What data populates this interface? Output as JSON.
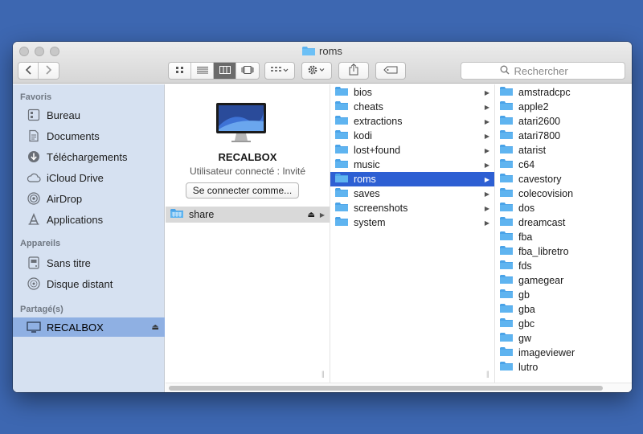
{
  "window": {
    "title": "roms"
  },
  "toolbar": {
    "search_placeholder": "Rechercher",
    "icons": [
      "back-icon",
      "forward-icon",
      "icon-view-icon",
      "list-view-icon",
      "column-view-icon",
      "coverflow-view-icon",
      "group-icon",
      "gear-icon",
      "share-icon",
      "tag-icon",
      "search-icon"
    ]
  },
  "sidebar": {
    "favorites_title": "Favoris",
    "favorites": [
      {
        "label": "Bureau",
        "icon": "desktop-icon"
      },
      {
        "label": "Documents",
        "icon": "documents-icon"
      },
      {
        "label": "Téléchargements",
        "icon": "downloads-icon"
      },
      {
        "label": "iCloud Drive",
        "icon": "cloud-icon"
      },
      {
        "label": "AirDrop",
        "icon": "airdrop-icon"
      },
      {
        "label": "Applications",
        "icon": "applications-icon"
      }
    ],
    "devices_title": "Appareils",
    "devices": [
      {
        "label": "Sans titre",
        "icon": "disk-icon"
      },
      {
        "label": "Disque distant",
        "icon": "optical-disk-icon"
      }
    ],
    "shared_title": "Partagé(s)",
    "shared": [
      {
        "label": "RECALBOX",
        "icon": "network-computer-icon"
      }
    ]
  },
  "server": {
    "name": "RECALBOX",
    "status": "Utilisateur connecté : Invité",
    "connect_label": "Se connecter comme...",
    "share_label": "share"
  },
  "column2": [
    "bios",
    "cheats",
    "extractions",
    "kodi",
    "lost+found",
    "music",
    "roms",
    "saves",
    "screenshots",
    "system"
  ],
  "column2_selected": "roms",
  "column3": [
    "amstradcpc",
    "apple2",
    "atari2600",
    "atari7800",
    "atarist",
    "c64",
    "cavestory",
    "colecovision",
    "dos",
    "dreamcast",
    "fba",
    "fba_libretro",
    "fds",
    "gamegear",
    "gb",
    "gba",
    "gbc",
    "gw",
    "imageviewer",
    "lutro"
  ],
  "colors": {
    "desktop": "#3d67b1",
    "sidebar": "#d6e1f1",
    "selection": "#2d5fd3",
    "sidebar_selection": "#8fb0e3",
    "folder": "#5fb4f0"
  }
}
